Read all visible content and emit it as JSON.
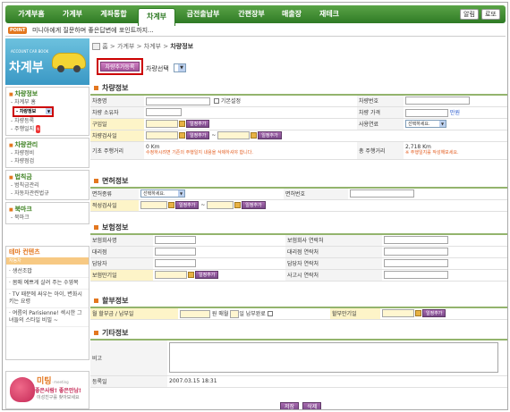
{
  "topnav": {
    "tabs": [
      "가계부홈",
      "가계부",
      "계좌통합",
      "차계부",
      "금전출납부",
      "간편장부",
      "매출장",
      "재테크"
    ],
    "active": 3,
    "utils": [
      "알림",
      "로또"
    ]
  },
  "pointbar": {
    "badge": "POINT",
    "text": "미니아에게 질문하며 좋은답변에 포인트까지..."
  },
  "logo": {
    "small": "ACCOUNT CAR BOOK",
    "big": "차계부"
  },
  "sidebar": {
    "groups": [
      {
        "title": "차량정보",
        "items": [
          "차계부 홈",
          "차량정보",
          "차량등록",
          "주행일지"
        ],
        "badge": "N"
      },
      {
        "title": "차량관리",
        "items": [
          "차량정비",
          "차량점검"
        ]
      },
      {
        "title": "법칙금",
        "items": [
          "범칙금관리",
          "자동차관련법규"
        ]
      },
      {
        "title": "북마크",
        "items": [
          "북마크"
        ]
      }
    ]
  },
  "theme": {
    "title": "테마 컨텐츠",
    "tag": "자동차",
    "items": [
      "생선조밥",
      "몸매 예쁘게 살려 주는 수영복",
      "TV 때문에 싸우는 아이, 변화시키는 요령",
      "여름의 Parisienne! 섹시한 그녀들의 스타일 비밀 ~"
    ]
  },
  "meeting": {
    "title": "미팅",
    "sub": "· meeting",
    "line1": "좋은사람! 좋은만남!",
    "line2": "이성친구를 찾아보세요"
  },
  "breadcrumb": {
    "home": "홈",
    "path1": "가계부",
    "path2": "차계부",
    "current": "차량정보"
  },
  "toolbar": {
    "add_button": "차량추가등록",
    "select_label": "차량선택"
  },
  "sections": {
    "car": "차량정보",
    "license": "면허정보",
    "insurance": "보험정보",
    "installment": "할부정보",
    "other": "기타정보"
  },
  "car_form": {
    "name": "차종명",
    "default": "기본설정",
    "number": "차량번호",
    "owner": "차량 소유자",
    "price": "차량 가격",
    "price_unit": "만원",
    "buy_date": "구입일",
    "add_schedule": "일정추가",
    "fuel": "사용연료",
    "fuel_select": "선택하세요.",
    "inspect_date": "차량검사일",
    "base_km": "기초 주행거리",
    "base_km_val": "0 Km",
    "base_km_note": "수정하시려면 기존의 주행일지 내용을 삭제하셔야 합니다.",
    "total_km": "총 주행거리",
    "total_km_val": "2,718 Km",
    "total_km_note": "※ 주행일지를 작성해보세요."
  },
  "license_form": {
    "type": "면허종류",
    "type_select": "선택하세요.",
    "number": "면허번호",
    "inspect": "적성검사일"
  },
  "insurance_form": {
    "company": "보험회사명",
    "company_tel": "보험회사 연락처",
    "agency": "대리점",
    "agency_tel": "대리점 연락처",
    "manager": "담당자",
    "manager_tel": "담당자 연락처",
    "expire": "보험만기일",
    "accident_tel": "사고시 연락처"
  },
  "installment_form": {
    "monthly": "월 할부금 / 납부일",
    "won_monthly": "원 매월",
    "paid_done": "일 납부완료",
    "expire": "할부만기일"
  },
  "other_form": {
    "memo": "비고",
    "reg": "등록일",
    "reg_val": "2007.03.15 18:31"
  },
  "buttons": {
    "save": "저장",
    "delete": "삭제"
  }
}
